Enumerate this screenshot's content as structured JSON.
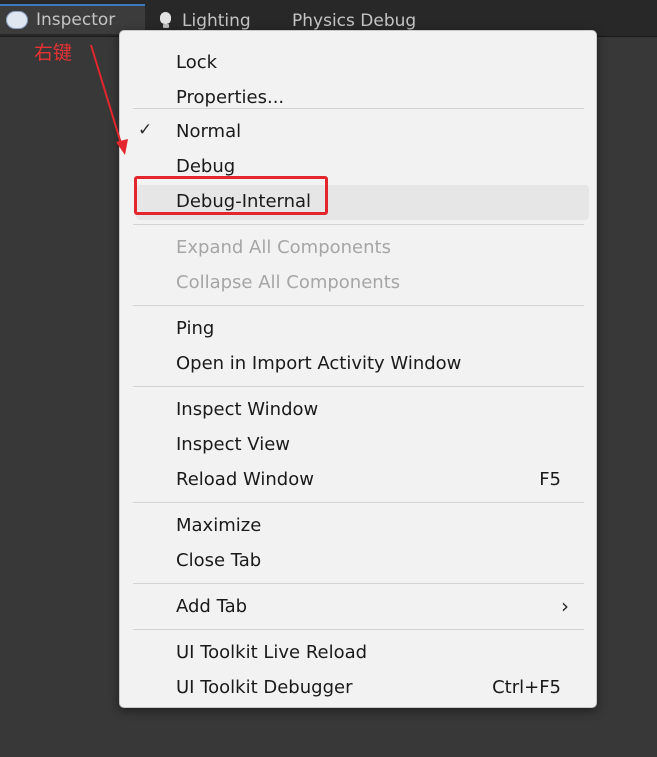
{
  "tabs": [
    {
      "label": "Inspector",
      "icon": "inspector-icon"
    },
    {
      "label": "Lighting",
      "icon": "bulb-icon"
    },
    {
      "label": "Physics Debug"
    }
  ],
  "annotation": {
    "label": "右键",
    "color": "#e63232"
  },
  "menu": {
    "items": [
      {
        "label": "Lock"
      },
      {
        "label": "Properties..."
      },
      {
        "label": "Normal",
        "checked": true
      },
      {
        "label": "Debug"
      },
      {
        "label": "Debug-Internal",
        "highlighted": true
      },
      {
        "label": "Expand All Components",
        "disabled": true
      },
      {
        "label": "Collapse All Components",
        "disabled": true
      },
      {
        "label": "Ping"
      },
      {
        "label": "Open in Import Activity Window"
      },
      {
        "label": "Inspect Window"
      },
      {
        "label": "Inspect View"
      },
      {
        "label": "Reload Window",
        "shortcut": "F5"
      },
      {
        "label": "Maximize"
      },
      {
        "label": "Close Tab"
      },
      {
        "label": "Add Tab",
        "submenu": true
      },
      {
        "label": "UI Toolkit Live Reload"
      },
      {
        "label": "UI Toolkit Debugger",
        "shortcut": "Ctrl+F5"
      }
    ],
    "check_glyph": "✓",
    "submenu_glyph": "›"
  },
  "colors": {
    "accent_tab": "#3a79bb",
    "highlight_box": "#e3262e",
    "menu_background": "#f2f2f2",
    "editor_background": "#383838"
  }
}
